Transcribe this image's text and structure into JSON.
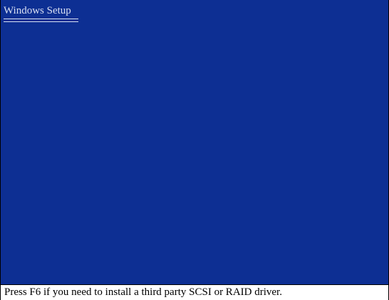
{
  "window": {
    "title": "Windows Setup"
  },
  "status_bar": {
    "message": "Press F6 if you need to install a third party SCSI or RAID driver."
  },
  "colors": {
    "background": "#0d2f93",
    "title_text": "#d9dff2",
    "status_bar_background": "#ffffff",
    "status_text": "#000000"
  }
}
